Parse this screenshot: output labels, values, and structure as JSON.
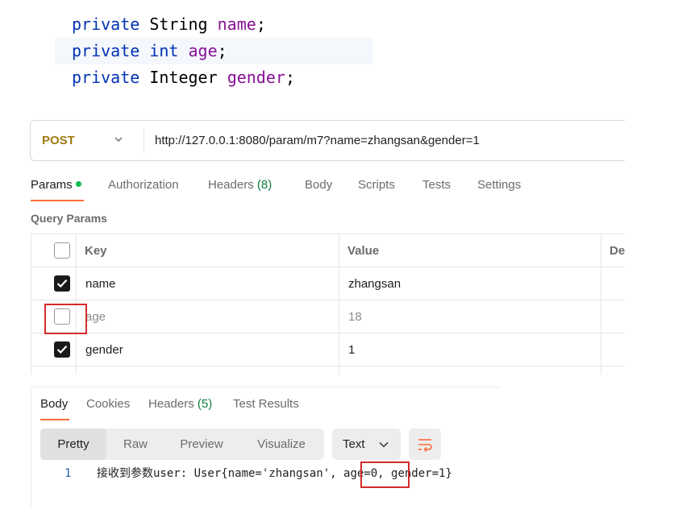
{
  "code": {
    "lines": [
      {
        "kw": "private",
        "type": "String",
        "field": "name",
        "end": ";"
      },
      {
        "kw": "private",
        "type": "int",
        "field": "age",
        "end": ";"
      },
      {
        "kw": "private",
        "type": "Integer",
        "field": "gender",
        "end": ";"
      }
    ]
  },
  "request": {
    "method": "POST",
    "url": "http://127.0.0.1:8080/param/m7?name=zhangsan&gender=1"
  },
  "tabs": {
    "params": "Params",
    "authorization": "Authorization",
    "headers": "Headers",
    "headers_count": "(8)",
    "body": "Body",
    "scripts": "Scripts",
    "tests": "Tests",
    "settings": "Settings"
  },
  "query_params": {
    "title": "Query Params",
    "columns": {
      "key": "Key",
      "value": "Value",
      "desc": "De"
    },
    "rows": [
      {
        "key": "name",
        "value": "zhangsan",
        "checked": true
      },
      {
        "key": "age",
        "value": "18",
        "checked": false
      },
      {
        "key": "gender",
        "value": "1",
        "checked": true
      }
    ]
  },
  "response": {
    "tabs": {
      "body": "Body",
      "cookies": "Cookies",
      "headers": "Headers",
      "headers_count": "(5)",
      "test_results": "Test Results"
    },
    "formats": {
      "pretty": "Pretty",
      "raw": "Raw",
      "preview": "Preview",
      "visualize": "Visualize"
    },
    "type_select": "Text",
    "line_number": "1",
    "line_before": "接收到参数user: User{name='zhangsan', ",
    "line_highlight": "age=0,",
    "line_after": " gender=1}"
  },
  "colors": {
    "accent": "#ff6c37",
    "method": "#a17a10",
    "highlight_box": "#d42a2a"
  }
}
